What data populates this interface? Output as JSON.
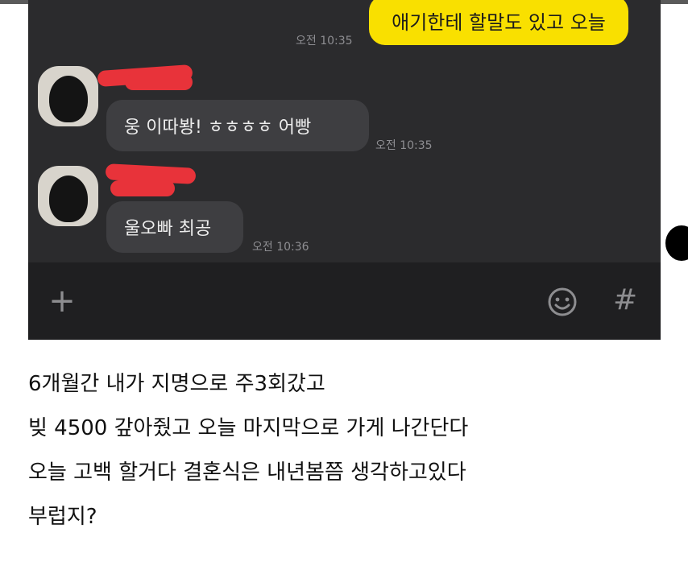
{
  "chat": {
    "messages": [
      {
        "sender": "me",
        "text": "애기한테 할말도 있고 오늘",
        "time": "오전 10:35"
      },
      {
        "sender": "other",
        "text": "웅 이따봥! ㅎㅎㅎㅎ 어빵",
        "time": "오전 10:35"
      },
      {
        "sender": "other",
        "text": "울오빠 최공",
        "time": "오전 10:36"
      }
    ],
    "input_bar": {
      "plus_icon": "+",
      "emoji_icon": "emoji-icon",
      "hash_icon": "#"
    }
  },
  "post": {
    "lines": [
      "6개월간 내가 지명으로 주3회갔고",
      "빚 4500 갚아줬고 오늘 마지막으로 가게 나간단다",
      "오늘 고백 할거다 결혼식은 내년봄쯤 생각하고있다",
      "부럽지?"
    ]
  },
  "colors": {
    "chat_bg": "#2b2b2d",
    "outgoing_bubble": "#f9e000",
    "incoming_bubble": "#3e3e41",
    "redaction": "#e8333a"
  }
}
